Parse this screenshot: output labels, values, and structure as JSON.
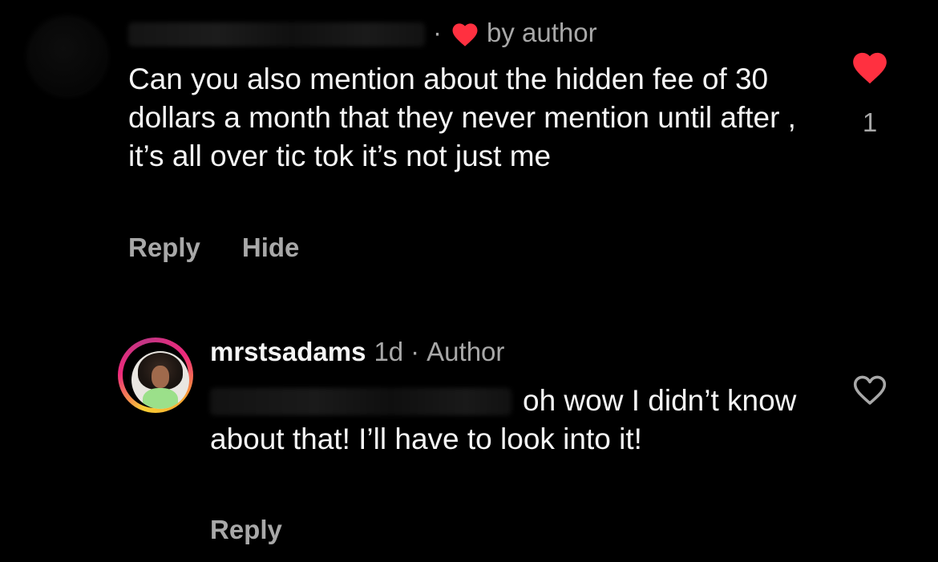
{
  "comment_top": {
    "username": "",
    "separator": "·",
    "liked_by_author_label": "by author",
    "body": "Can you also mention about the hidden fee of 30 dollars a month that they never mention until after , it’s all over tic tok it’s not just me",
    "actions": {
      "reply": "Reply",
      "hide": "Hide"
    },
    "like_count": "1",
    "liked": true,
    "like_color": "#ff3040"
  },
  "comment_reply": {
    "username": "mrstsadams",
    "time": "1d",
    "separator": "·",
    "role": "Author",
    "body": "oh wow I didn’t know about that! I’ll have to look into it!",
    "actions": {
      "reply": "Reply"
    },
    "liked": false
  },
  "icons": {
    "author_heart": "heart-filled-icon",
    "like_top": "heart-filled-icon",
    "like_reply": "heart-outline-icon"
  }
}
